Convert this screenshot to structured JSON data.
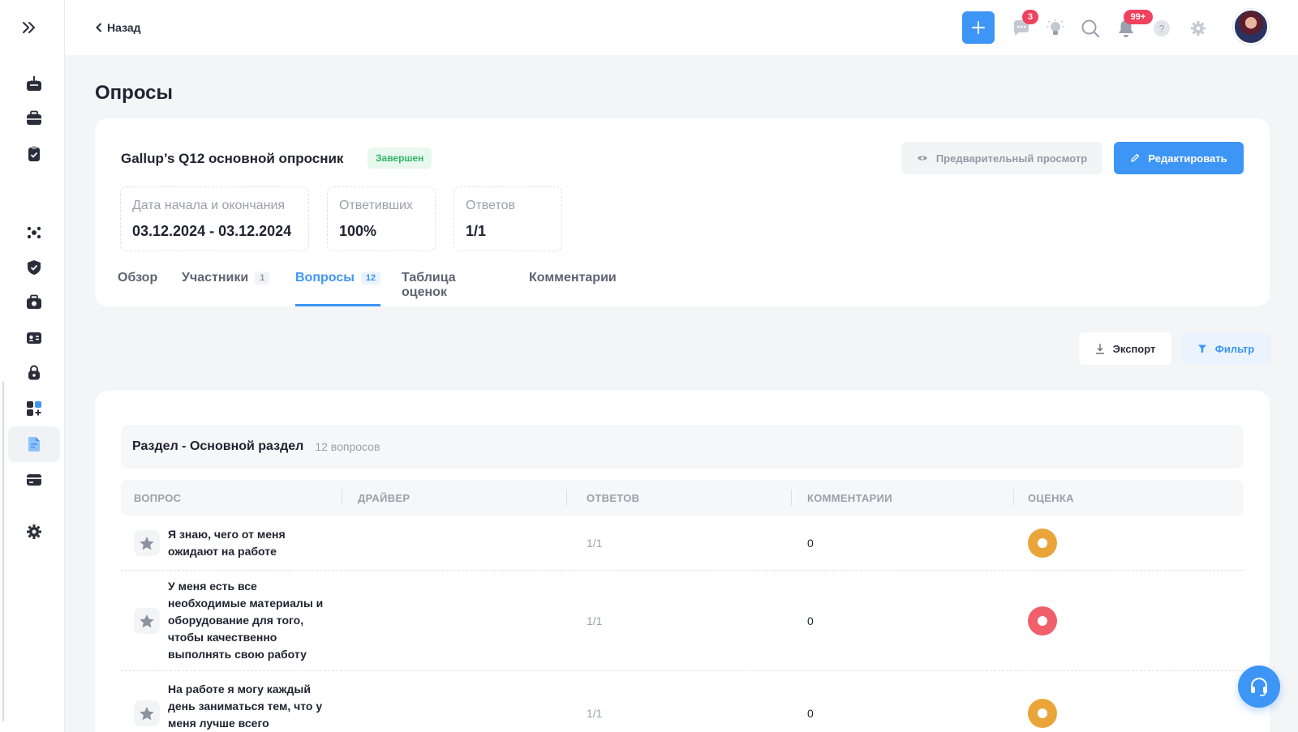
{
  "topbar": {
    "back_label": "Назад",
    "chat_badge": "3",
    "notif_badge": "99+",
    "accent": "#3d95f5"
  },
  "page": {
    "title": "Опросы"
  },
  "survey": {
    "name": "Gallup’s Q12 основной опросник",
    "status": "Завершен",
    "preview_label": "Предварительный просмотр",
    "edit_label": "Редактировать",
    "stats": [
      {
        "label": "Дата начала и окончания",
        "value": "03.12.2024 - 03.12.2024"
      },
      {
        "label": "Ответивших",
        "value": "100%"
      },
      {
        "label": "Ответов",
        "value": "1/1"
      }
    ],
    "tabs": [
      {
        "label": "Обзор",
        "count": ""
      },
      {
        "label": "Участники",
        "count": "1"
      },
      {
        "label": "Вопросы",
        "count": "12",
        "active": true
      },
      {
        "label": "Таблица оценок",
        "count": ""
      },
      {
        "label": "Комментарии",
        "count": ""
      }
    ]
  },
  "toolbar": {
    "export_label": "Экспорт",
    "filter_label": "Фильтр"
  },
  "section": {
    "title": "Раздел - Основной раздел",
    "count": "12 вопросов"
  },
  "table": {
    "columns": [
      "ВОПРОС",
      "ДРАЙВЕР",
      "ОТВЕТОВ",
      "КОММЕНТАРИИ",
      "ОЦЕНКА"
    ],
    "rows": [
      {
        "question": "Я знаю, чего от меня ожидают на работе",
        "driver": "",
        "answers": "1/1",
        "comments": "0",
        "score_color": "#e9a53a"
      },
      {
        "question": "У меня есть все необходимые материалы и оборудование для того, чтобы качественно выполнять свою работу",
        "driver": "",
        "answers": "1/1",
        "comments": "0",
        "score_color": "#f0606b"
      },
      {
        "question": "На работе я могу каждый день заниматься тем, что у меня лучше всего",
        "driver": "",
        "answers": "1/1",
        "comments": "0",
        "score_color": "#e9a53a"
      }
    ]
  },
  "icons": {
    "sidebar": [
      "inbox-icon",
      "briefcase-icon",
      "clipboard-icon",
      "team-icon",
      "shield-icon",
      "briefcase-check-icon",
      "id-card-icon",
      "lock-icon",
      "apps-add-icon",
      "document-icon",
      "card-icon",
      "gear-icon"
    ]
  }
}
